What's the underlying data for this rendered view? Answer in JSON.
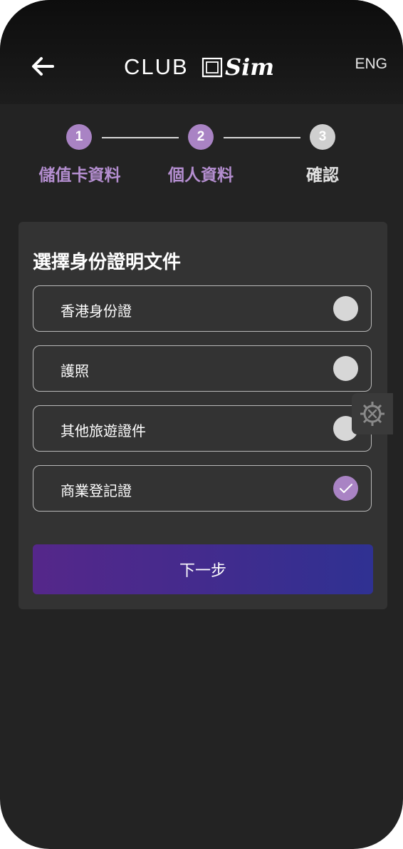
{
  "header": {
    "back_icon": "arrow-left-icon",
    "logo_text": "CLUB",
    "logo_script": "Sim",
    "lang_label": "ENG"
  },
  "stepper": {
    "steps": [
      {
        "number": "1",
        "label": "儲值卡資料",
        "state": "done"
      },
      {
        "number": "2",
        "label": "個人資料",
        "state": "active"
      },
      {
        "number": "3",
        "label": "確認",
        "state": "pending"
      }
    ]
  },
  "form": {
    "title": "選擇身份證明文件",
    "options": [
      {
        "label": "香港身份證",
        "selected": false
      },
      {
        "label": "護照",
        "selected": false
      },
      {
        "label": "其他旅遊證件",
        "selected": false
      },
      {
        "label": "商業登記證",
        "selected": true
      }
    ],
    "next_label": "下一步"
  },
  "colors": {
    "background": "#232323",
    "card": "#333333",
    "accent": "#a983c4",
    "button_gradient_start": "#55278a",
    "button_gradient_end": "#2f3192"
  },
  "floating": {
    "gear_icon": "gear-icon"
  }
}
